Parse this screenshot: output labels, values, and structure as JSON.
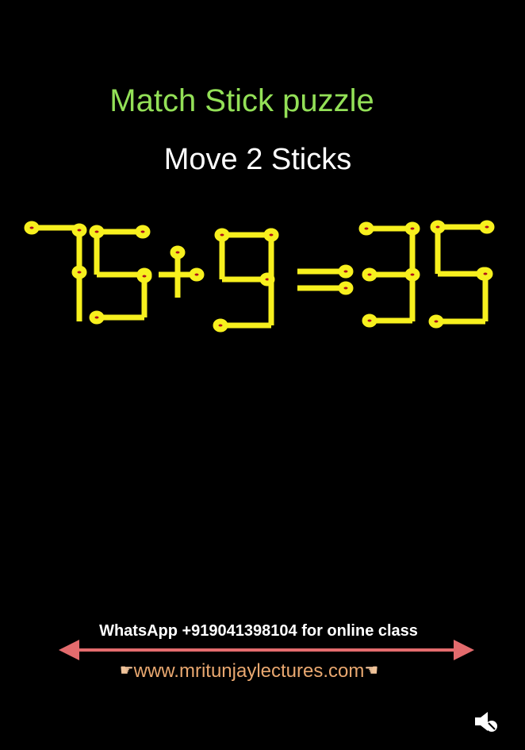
{
  "title": "Match Stick puzzle",
  "subtitle": "Move 2 Sticks",
  "equation": {
    "text": "75+9=35",
    "glyphs": [
      "7",
      "5",
      "+",
      "9",
      "=",
      "3",
      "5"
    ]
  },
  "colors": {
    "background": "#000000",
    "title": "#93e057",
    "stick": "#f7f01e",
    "match_head": "#b0121a",
    "arrow": "#e36b6d",
    "website": "#e9a870"
  },
  "footer": {
    "whatsapp_text": "WhatsApp +919041398104 for online class",
    "website": "www.mritunjaylectures.com",
    "left_icon": "pointing-right-icon",
    "right_icon": "pointing-left-icon"
  },
  "controls": {
    "mute_icon": "speaker-muted-icon"
  }
}
